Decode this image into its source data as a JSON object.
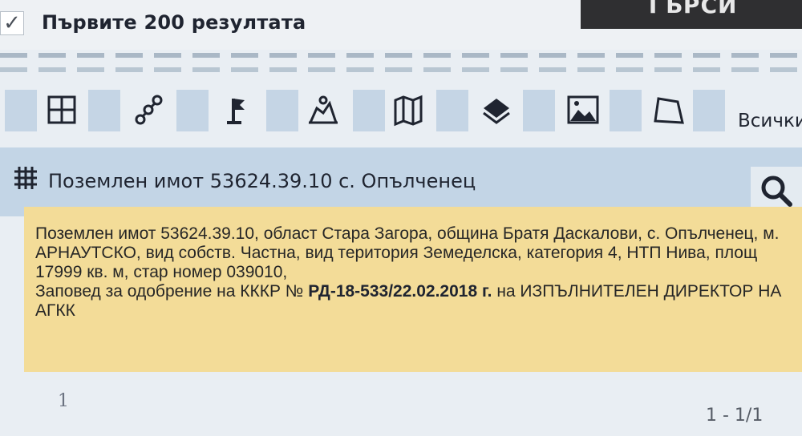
{
  "filters": {
    "first_200_checkbox": {
      "checked": true,
      "label": "Първите 200 резултата"
    },
    "search_button_label": "ТЪРСИ"
  },
  "toolbar": {
    "icons": [
      "grid-icon",
      "route-icon",
      "flag-icon",
      "building-icon",
      "map-icon",
      "layers-icon",
      "image-icon",
      "polygon-icon"
    ],
    "all_label": "Всички"
  },
  "result": {
    "title": "Поземлен имот 53624.39.10 с. Опълченец",
    "details": {
      "part1": "Поземлен имот 53624.39.10, област Стара Загора, община Братя Даскалови, с. Опълченец, м. АРНАУТСКО, вид собств. Частна, вид територия Земеделска, категория 4, НТП Нива, площ 17999 кв. м, стар номер 039010,",
      "part2": "Заповед за одобрение на КККР №",
      "order_number": "РД-18-533/22.02.2018 г.",
      "part3": "на ИЗПЪЛНИТЕЛЕН ДИРЕКТОР НА АГКК"
    }
  },
  "pagination": {
    "current_page": "1",
    "summary": "1 - 1/1"
  },
  "colors": {
    "background": "#e9eef3",
    "header_blue": "#c3d5e6",
    "detail_yellow": "#f3dc98",
    "search_dark": "#2f2f31"
  }
}
